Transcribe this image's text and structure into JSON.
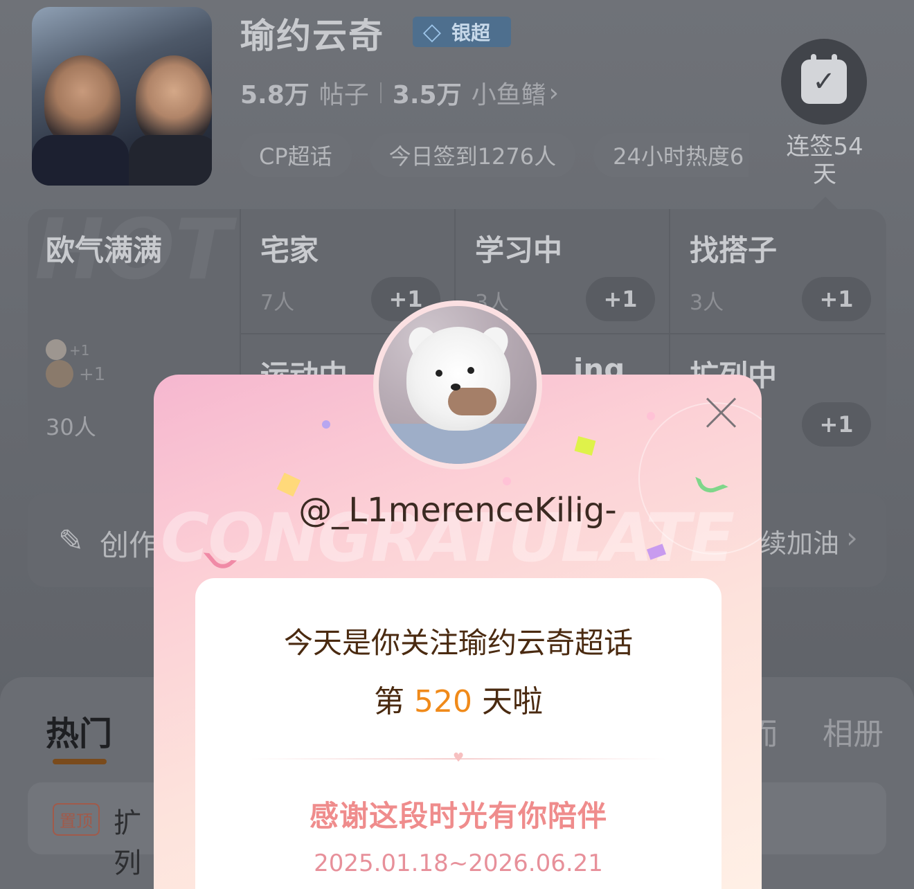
{
  "topic": {
    "name": "瑜约云奇",
    "badge_label": "银超",
    "posts_count": "5.8万",
    "posts_label": "帖子",
    "fans_count": "3.5万",
    "fans_label": "小鱼鳍",
    "chips": [
      "CP超话",
      "今日签到1276人",
      "24小时热度6"
    ]
  },
  "checkin": {
    "label": "连签54天"
  },
  "moods": {
    "featured": {
      "title": "欧气满满",
      "count": "30人",
      "plus_a": "+1",
      "plus_b": "+1",
      "watermark": "HOT"
    },
    "cells": [
      {
        "title": "宅家",
        "count": "7人",
        "btn": "+1"
      },
      {
        "title": "学习中",
        "count": "3人",
        "btn": "+1"
      },
      {
        "title": "找搭子",
        "count": "3人",
        "btn": "+1"
      },
      {
        "title": "运动中",
        "count": "",
        "btn": ""
      },
      {
        "title": "ing",
        "count": "",
        "btn": ""
      },
      {
        "title": "扩列中",
        "count": "",
        "btn": "+1"
      }
    ]
  },
  "create": {
    "label": "创作",
    "right_text": "续加油"
  },
  "tabs": {
    "hot": "热门",
    "partial": "而",
    "album": "相册"
  },
  "post": {
    "pin": "置顶",
    "title": "扩列"
  },
  "modal": {
    "username": "@_L1merenceKilig-",
    "watermark": "CONGRATULATE",
    "line1": "今天是你关注瑜约云奇超话",
    "line2_prefix": "第 ",
    "days": "520",
    "line2_suffix": " 天啦",
    "thanks": "感谢这段时光有你陪伴",
    "dates": "2025.01.18~2026.06.21"
  },
  "icons": {
    "close": "close-icon",
    "calendar": "calendar-check-icon",
    "create": "pen-icon",
    "chevron": "chevron-right-icon",
    "gem": "diamond-icon"
  }
}
